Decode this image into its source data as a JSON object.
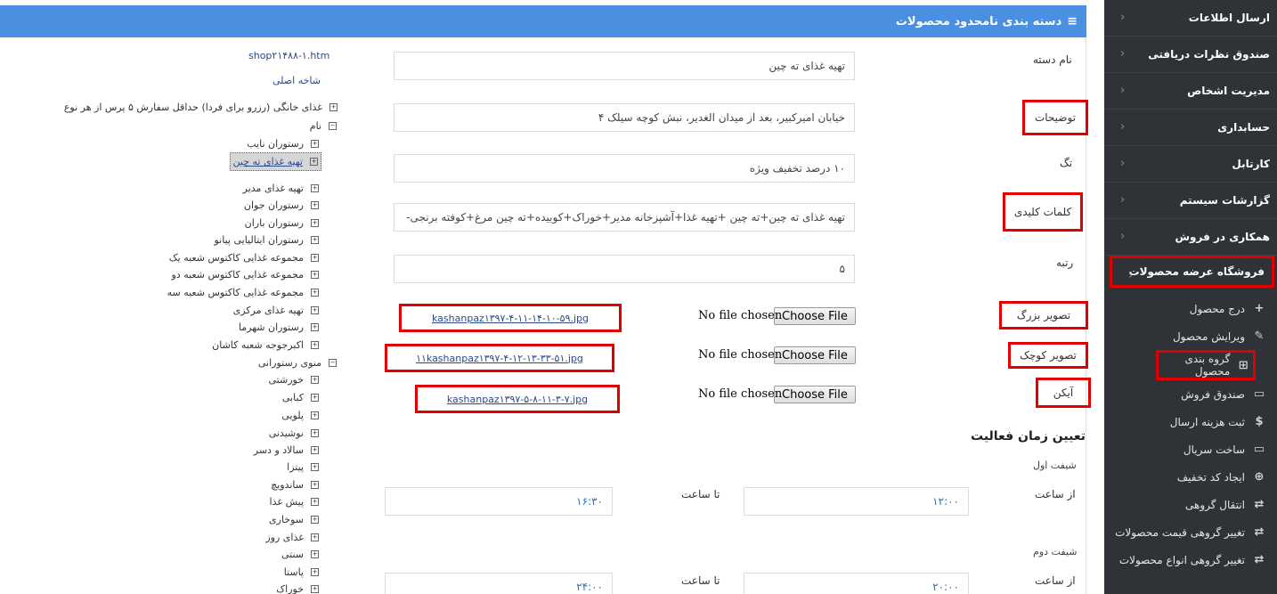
{
  "header": {
    "title": "دسته بندی نامحدود محصولات",
    "menu_icon": "≡"
  },
  "sidebar": {
    "items": [
      {
        "label": "ارسال اطلاعات"
      },
      {
        "label": "صندوق نظرات دریافتی"
      },
      {
        "label": "مدیریت اشخاص"
      },
      {
        "label": "حسابداری"
      },
      {
        "label": "کارتابل"
      },
      {
        "label": "گزارشات سیستم"
      },
      {
        "label": "همکاری در فروش"
      },
      {
        "label": "فروشگاه عرضه محصولات"
      }
    ],
    "sub_items": [
      {
        "label": "درج محصول",
        "icon": "+"
      },
      {
        "label": "ویرایش محصول",
        "icon": "✎"
      },
      {
        "label": "گروه بندی محصول",
        "icon": "⊞"
      },
      {
        "label": "صندوق فروش",
        "icon": "▭"
      },
      {
        "label": "ثبت هزینه ارسال",
        "icon": "$"
      },
      {
        "label": "ساخت سریال",
        "icon": "▭"
      },
      {
        "label": "ایجاد کد تخفیف",
        "icon": "⊕"
      },
      {
        "label": "انتقال گروهی",
        "icon": "⇄"
      },
      {
        "label": "تغییر گروهی قیمت محصولات",
        "icon": "⇄"
      },
      {
        "label": "تغییر گروهی انواع محصولات",
        "icon": "⇄"
      }
    ]
  },
  "form": {
    "name_label": "نام دسته",
    "name_value": "تهیه غذای ته چین",
    "desc_label": "توضیحات",
    "desc_value": "خیابان امیرکبیر، بعد از میدان الغدیر، نبش کوچه سیلک ۴",
    "tag_label": "تگ",
    "tag_value": "۱۰ درصد تخفیف ویژه",
    "keywords_label": "کلمات کلیدی",
    "keywords_value": "تهیه غذای ته چین+ته چین +تهیه غذا+آشپزخانه مدیر+خوراک+کوبیده+ته چین مرغ+کوفته برنجی-",
    "rank_label": "رتبه",
    "rank_value": "۵",
    "big_image_label": "تصویر بزرگ",
    "small_image_label": "تصویر کوچک",
    "icon_label": "آیکن",
    "choose_file": "Choose File",
    "no_file": "No file chosen",
    "big_image_file": "kashanpaz۱۳۹۷-۴-۱۱-۱۴-۱۰-۵۹.jpg",
    "small_image_file": "۱۱kashanpaz۱۳۹۷-۴-۱۲-۱۳-۳۳-۵۱.jpg",
    "icon_file": "kashanpaz۱۳۹۷-۵-۸-۱۱-۳-۷.jpg"
  },
  "schedule": {
    "title": "تعیین زمان فعالیت",
    "shift1_label": "شیفت اول",
    "shift2_label": "شیفت دوم",
    "from_label": "از ساعت",
    "to_label": "تا ساعت",
    "shift1_from": "۱۲:۰۰",
    "shift1_to": "۱۶:۳۰",
    "shift2_from": "۲۰:۰۰",
    "shift2_to": "۲۴:۰۰"
  },
  "tree": {
    "file_link": "shop۲۱۴۸۸-۱.htm",
    "root_label": "شاخه اصلی",
    "nodes": [
      {
        "label": "غذای خانگی (رزرو برای فردا) حداقل سفارش ۵ پرس از هر نوع",
        "box": "+"
      },
      {
        "label": "نام",
        "box": "−"
      },
      {
        "label": "رستوران نایب",
        "box": "+"
      },
      {
        "label": "تهیه غذای ته چین",
        "box": "+"
      },
      {
        "label": "تهیه غذای مدیر",
        "box": "+"
      },
      {
        "label": "رستوران جوان",
        "box": "+"
      },
      {
        "label": "رستوران باران",
        "box": "+"
      },
      {
        "label": "رستوران ایتالیایی پیانو",
        "box": "+"
      },
      {
        "label": "مجموعه غذایی کاکتوس شعبه یک",
        "box": "+"
      },
      {
        "label": "مجموعه غذایی کاکتوس شعبه دو",
        "box": "+"
      },
      {
        "label": "مجموعه غذایی کاکتوس شعبه سه",
        "box": "+"
      },
      {
        "label": "تهیه غذای مرکزی",
        "box": "+"
      },
      {
        "label": "رستوران شهرما",
        "box": "+"
      },
      {
        "label": "اکبرجوجه شعبه کاشان",
        "box": "+"
      },
      {
        "label": "منوی رستورانی",
        "box": "−"
      },
      {
        "label": "خورشتی",
        "box": "+"
      },
      {
        "label": "کبابی",
        "box": "+"
      },
      {
        "label": "پلویی",
        "box": "+"
      },
      {
        "label": "نوشیدنی",
        "box": "+"
      },
      {
        "label": "سالاد و دسر",
        "box": "+"
      },
      {
        "label": "پیتزا",
        "box": "+"
      },
      {
        "label": "ساندویچ",
        "box": "+"
      },
      {
        "label": "پیش غذا",
        "box": "+"
      },
      {
        "label": "سوخاری",
        "box": "+"
      },
      {
        "label": "غذای روز",
        "box": "+"
      },
      {
        "label": "سنتی",
        "box": "+"
      },
      {
        "label": "پاستا",
        "box": "+"
      },
      {
        "label": "خوراک",
        "box": "+"
      }
    ]
  }
}
